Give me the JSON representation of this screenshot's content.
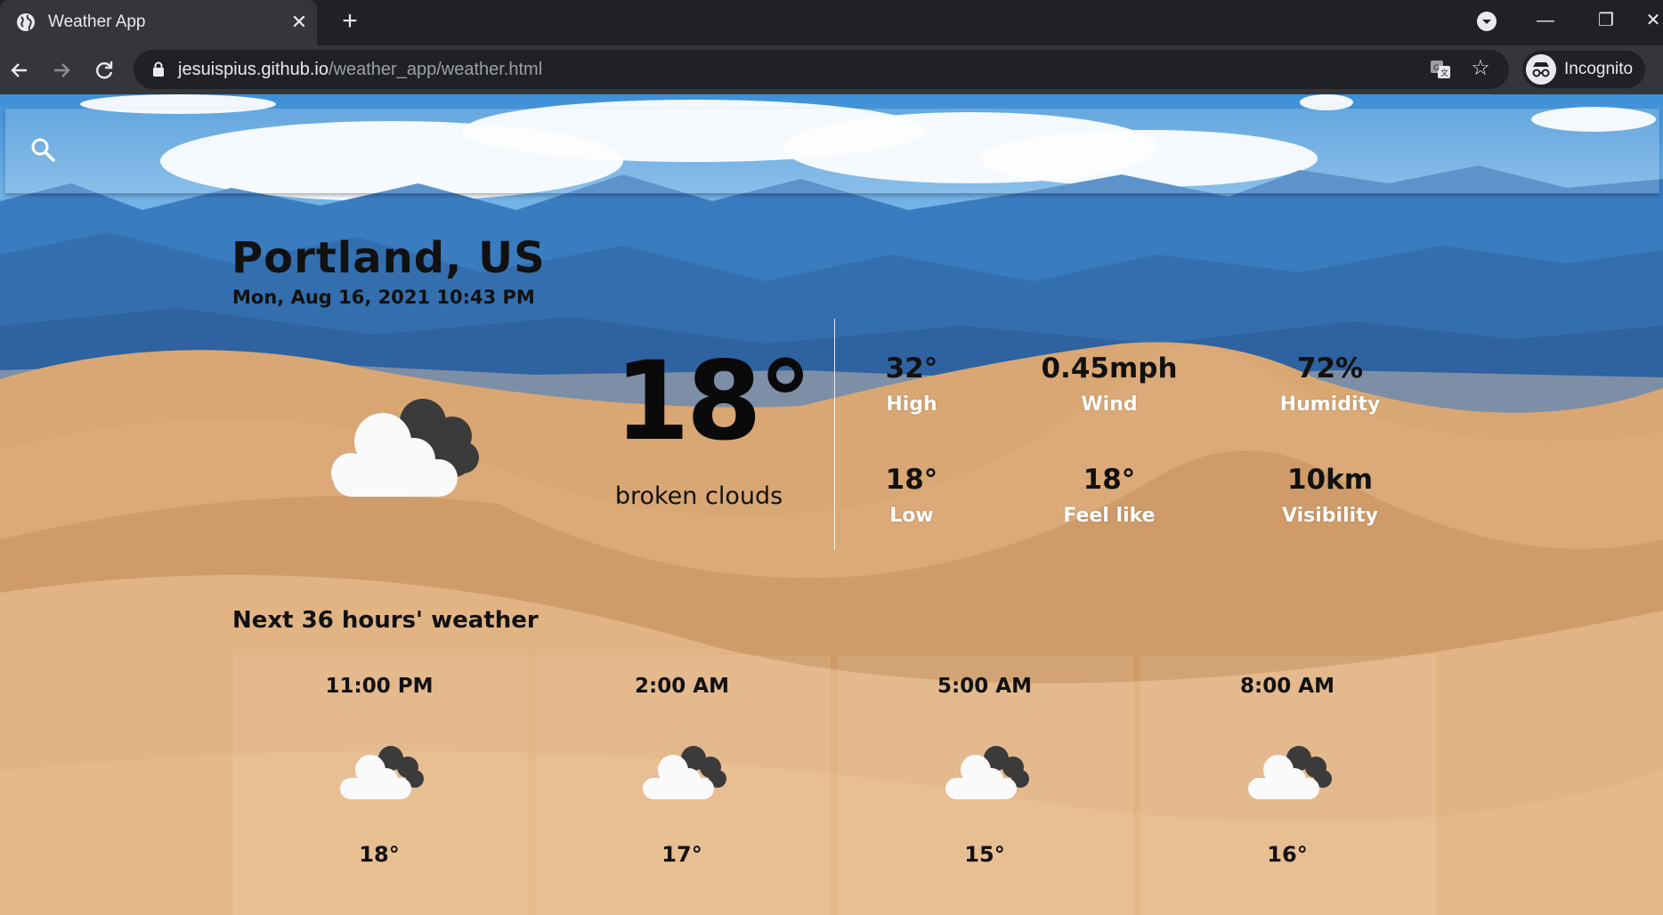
{
  "browser": {
    "tab_title": "Weather App",
    "url_host": "jesuispius.github.io",
    "url_path": "/weather_app/weather.html",
    "profile_label": "Incognito",
    "icons": [
      "globe-icon",
      "close-icon",
      "plus-icon",
      "tab-search-icon",
      "back-icon",
      "forward-icon",
      "reload-icon",
      "lock-icon",
      "translate-icon",
      "star-icon",
      "incognito-icon"
    ]
  },
  "weather": {
    "city": "Portland, US",
    "datetime": "Mon, Aug 16, 2021 10:43 PM",
    "temperature": "18°",
    "description": "broken clouds",
    "icon": "broken-clouds-icon",
    "stats": [
      {
        "value": "32°",
        "label": "High"
      },
      {
        "value": "0.45mph",
        "label": "Wind"
      },
      {
        "value": "72%",
        "label": "Humidity"
      },
      {
        "value": "18°",
        "label": "Low"
      },
      {
        "value": "18°",
        "label": "Feel like"
      },
      {
        "value": "10km",
        "label": "Visibility"
      }
    ]
  },
  "forecast": {
    "title": "Next 36 hours' weather",
    "items": [
      {
        "time": "11:00 PM",
        "temp": "18°",
        "icon": "broken-clouds-icon"
      },
      {
        "time": "2:00 AM",
        "temp": "17°",
        "icon": "broken-clouds-icon"
      },
      {
        "time": "5:00 AM",
        "temp": "15°",
        "icon": "broken-clouds-icon"
      },
      {
        "time": "8:00 AM",
        "temp": "16°",
        "icon": "broken-clouds-icon"
      }
    ]
  },
  "colors": {
    "chrome_dark": "#202124",
    "chrome_tab": "#35363a",
    "text_dark": "#111111",
    "label_white": "#ffffff"
  }
}
